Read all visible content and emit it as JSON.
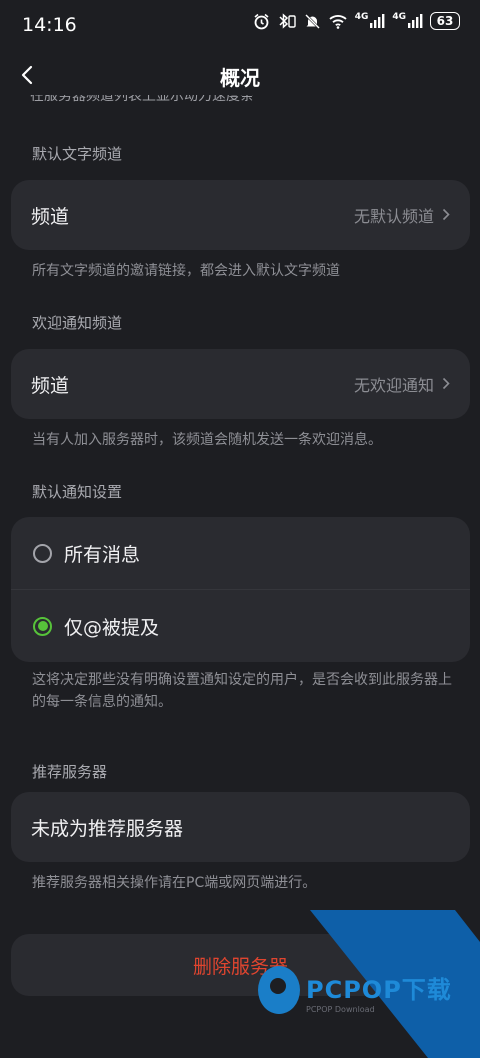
{
  "status_bar": {
    "time": "14:16",
    "signal1_label": "4G",
    "signal2_label": "4G",
    "battery": "63"
  },
  "header": {
    "title": "概况",
    "back_icon": "chevron-left-icon"
  },
  "cut_text": "在服务器频道列表上显示动力速度条",
  "default_text_channel": {
    "section_label": "默认文字频道",
    "row_label": "频道",
    "row_value": "无默认频道",
    "hint": "所有文字频道的邀请链接，都会进入默认文字频道"
  },
  "welcome_channel": {
    "section_label": "欢迎通知频道",
    "row_label": "频道",
    "row_value": "无欢迎通知",
    "hint": "当有人加入服务器时，该频道会随机发送一条欢迎消息。"
  },
  "notification_settings": {
    "section_label": "默认通知设置",
    "options": [
      {
        "label": "所有消息",
        "selected": false
      },
      {
        "label": "仅@被提及",
        "selected": true
      }
    ],
    "hint": "这将决定那些没有明确设置通知设定的用户，是否会收到此服务器上的每一条信息的通知。"
  },
  "recommend": {
    "section_label": "推荐服务器",
    "row_label": "未成为推荐服务器",
    "hint": "推荐服务器相关操作请在PC端或网页端进行。"
  },
  "delete_button": {
    "label": "删除服务器",
    "color": "#e0452f"
  },
  "watermark": {
    "brand": "PCPOP下载",
    "sub": "PCPOP Download",
    "color": "#0e5fa8"
  },
  "colors": {
    "background": "#1d1e22",
    "card": "#2a2b30",
    "accent_green": "#57c33a"
  }
}
